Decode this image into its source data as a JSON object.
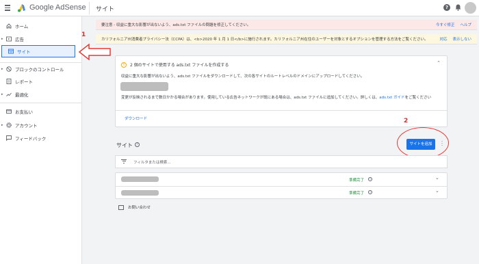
{
  "header": {
    "app_name": "Google AdSense",
    "page_title": "サイト",
    "help_icon": "?"
  },
  "sidebar": {
    "items": [
      {
        "label": "ホーム",
        "icon": "home-icon",
        "caret": ""
      },
      {
        "label": "広告",
        "icon": "ads-icon",
        "caret": "▸"
      },
      {
        "label": "サイト",
        "icon": "sites-icon",
        "caret": ""
      },
      {
        "label": "ブロックのコントロール",
        "icon": "block-icon",
        "caret": "▸"
      },
      {
        "label": "レポート",
        "icon": "report-icon",
        "caret": ""
      },
      {
        "label": "最適化",
        "icon": "optimize-icon",
        "caret": "▸"
      },
      {
        "label": "お支払い",
        "icon": "payments-icon",
        "caret": ""
      },
      {
        "label": "アカウント",
        "icon": "account-icon",
        "caret": "▸"
      },
      {
        "label": "フィードバック",
        "icon": "feedback-icon",
        "caret": ""
      }
    ]
  },
  "annotations": {
    "num1": "1",
    "num2": "2"
  },
  "banners": {
    "pink": {
      "text": "要注意 - 収益に重大な影響が出ないよう、ads.txt ファイルの問題を修正してください。",
      "link1": "今すぐ修正",
      "link2": "ヘルプ"
    },
    "yellow": {
      "text": "カリフォルニア州消費者プライバシー法（CCPA）は、<b>2020 年 1 月 1 日</b>に施行されます。カリフォルニア州在住のユーザーを対象とするオプションを管理する方法をご覧ください。",
      "link1": "対応",
      "link2": "表示しない"
    }
  },
  "adstxt_card": {
    "title": "2 個のサイトで使用する ads.txt ファイルを作成する",
    "body1": "収益に重大な影響が出ないよう、ads.txt ファイルをダウンロードして、次の各サイトのルートレベルのドメインにアップロードしてください。",
    "body2_pre": "変更が反映されるまで数日かかる場合があります。使用している広告ネットワークが既にある場合は、ads.txt ファイルに追加してください。詳しくは、",
    "body2_link": "ads.txt ガイド",
    "body2_post": "をご覧ください",
    "download": "ダウンロード"
  },
  "sites_section": {
    "title": "サイト",
    "help_glyph": "?",
    "add_button": "サイトを追加",
    "filter_placeholder": "フィルタまたは検索...",
    "rows": [
      {
        "status": "準備完了"
      },
      {
        "status": "準備完了"
      }
    ],
    "info_glyph": "i",
    "contact": "お問い合わせ"
  },
  "colors": {
    "accent": "#1a73e8",
    "annotation_red": "#e53935",
    "status_green": "#1e8e3e"
  }
}
